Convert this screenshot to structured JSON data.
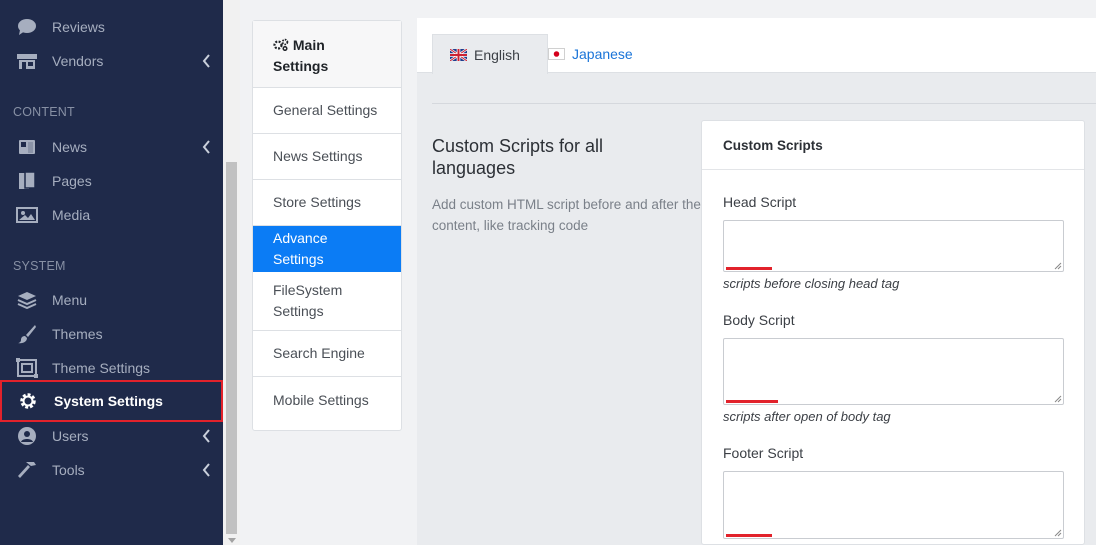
{
  "sidebar": {
    "items_top": [
      {
        "label": "Reviews",
        "icon": "speech-bubble-icon"
      },
      {
        "label": "Vendors",
        "icon": "store-icon"
      }
    ],
    "section_content": "CONTENT",
    "items_content": [
      {
        "label": "News",
        "icon": "newspaper-icon"
      },
      {
        "label": "Pages",
        "icon": "pages-icon"
      },
      {
        "label": "Media",
        "icon": "image-icon"
      }
    ],
    "section_system": "SYSTEM",
    "items_system": [
      {
        "label": "Menu",
        "icon": "layers-icon"
      },
      {
        "label": "Themes",
        "icon": "paintbrush-icon"
      },
      {
        "label": "Theme Settings",
        "icon": "theme-settings-icon"
      },
      {
        "label": "System Settings",
        "icon": "gear-icon"
      },
      {
        "label": "Users",
        "icon": "users-icon"
      },
      {
        "label": "Tools",
        "icon": "hammer-icon"
      }
    ],
    "highlight_color": "#e2222b"
  },
  "settings_menu": {
    "title": "Main Settings",
    "items": [
      "General Settings",
      "News Settings",
      "Store Settings",
      "Advance Settings",
      "FileSystem Settings",
      "Search Engine",
      "Mobile Settings"
    ],
    "active": "Advance Settings",
    "accent": "#0b7cf5"
  },
  "tabs": {
    "english": "English",
    "japanese": "Japanese"
  },
  "section": {
    "title": "Custom Scripts for all languages",
    "description": "Add custom HTML script before and after the content, like tracking code"
  },
  "card": {
    "title": "Custom Scripts",
    "head_label": "Head Script",
    "head_hint": "scripts before closing head tag",
    "body_label": "Body Script",
    "body_hint": "scripts after open of body tag",
    "footer_label": "Footer Script"
  }
}
